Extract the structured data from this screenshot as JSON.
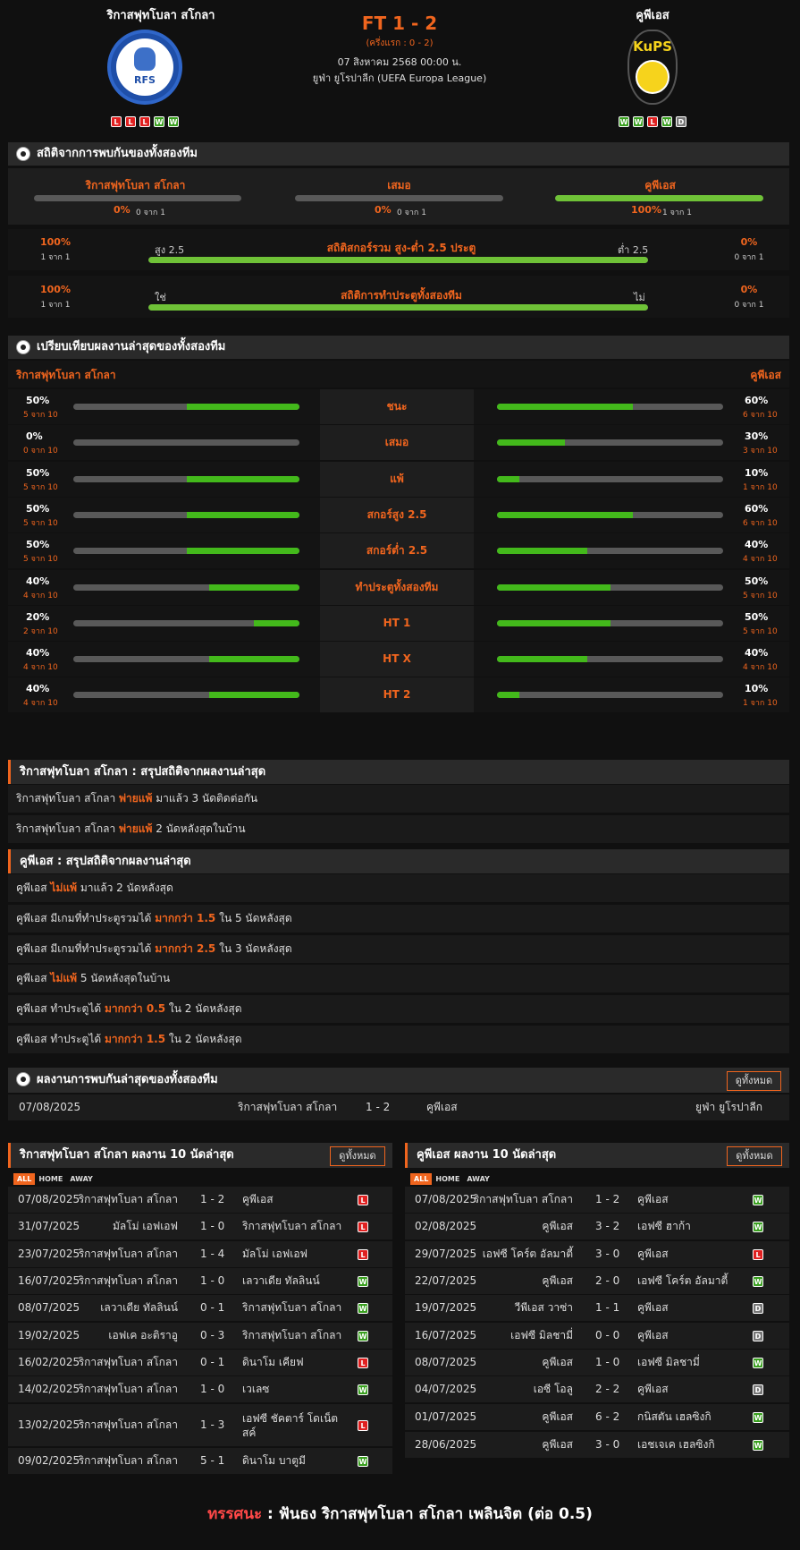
{
  "match": {
    "home": "ริกาสฟุทโบลา สโกลา",
    "away": "คูพีเอส",
    "score": "FT 1 - 2",
    "ht": "(ครึ่งแรก : 0 - 2)",
    "date": "07 สิงหาคม 2568 00:00 น.",
    "league": "ยูฟ่า ยูโรปาลีก (UEFA Europa League)",
    "home_logo_text": "RFS",
    "away_logo_text": "KuPS",
    "home_form": [
      "L",
      "L",
      "L",
      "W",
      "W"
    ],
    "away_form": [
      "W",
      "W",
      "L",
      "W",
      "D"
    ]
  },
  "h2h_stats": {
    "title": "สถิติจากการพบกันของทั้งสองทีม",
    "draw_label": "เสมอ",
    "home_pct": "0%",
    "home_sub": "0 จาก 1",
    "draw_pct": "0%",
    "draw_sub": "0 จาก 1",
    "away_pct": "100%",
    "away_sub": "1 จาก 1",
    "home_val": 0,
    "draw_val": 0,
    "away_val": 100
  },
  "ou": {
    "title": "สถิติสกอร์รวม สูง-ต่ำ 2.5 ประตู",
    "left_label": "สูง 2.5",
    "right_label": "ต่ำ 2.5",
    "left_pct": "100%",
    "left_sub": "1 จาก 1",
    "right_pct": "0%",
    "right_sub": "0 จาก 1",
    "value": 100
  },
  "btts": {
    "title": "สถิติการทำประตูทั้งสองทีม",
    "left_label": "ใช่",
    "right_label": "ไม่",
    "left_pct": "100%",
    "left_sub": "1 จาก 1",
    "right_pct": "0%",
    "right_sub": "0 จาก 1",
    "value": 100
  },
  "compare": {
    "title": "เปรียบเทียบผลงานล่าสุดของทั้งสองทีม",
    "rows": [
      {
        "label": "ชนะ",
        "lp": "50%",
        "ls": "5 จาก 10",
        "lv": 50,
        "rp": "60%",
        "rs": "6 จาก 10",
        "rv": 60
      },
      {
        "label": "เสมอ",
        "lp": "0%",
        "ls": "0 จาก 10",
        "lv": 0,
        "rp": "30%",
        "rs": "3 จาก 10",
        "rv": 30
      },
      {
        "label": "แพ้",
        "lp": "50%",
        "ls": "5 จาก 10",
        "lv": 50,
        "rp": "10%",
        "rs": "1 จาก 10",
        "rv": 10
      },
      {
        "label": "สกอร์สูง 2.5",
        "lp": "50%",
        "ls": "5 จาก 10",
        "lv": 50,
        "rp": "60%",
        "rs": "6 จาก 10",
        "rv": 60
      },
      {
        "label": "สกอร์ต่ำ 2.5",
        "lp": "50%",
        "ls": "5 จาก 10",
        "lv": 50,
        "rp": "40%",
        "rs": "4 จาก 10",
        "rv": 40
      },
      {
        "label": "ทำประตูทั้งสองทีม",
        "lp": "40%",
        "ls": "4 จาก 10",
        "lv": 40,
        "rp": "50%",
        "rs": "5 จาก 10",
        "rv": 50
      },
      {
        "label": "HT 1",
        "lp": "20%",
        "ls": "2 จาก 10",
        "lv": 20,
        "rp": "50%",
        "rs": "5 จาก 10",
        "rv": 50
      },
      {
        "label": "HT X",
        "lp": "40%",
        "ls": "4 จาก 10",
        "lv": 40,
        "rp": "40%",
        "rs": "4 จาก 10",
        "rv": 40
      },
      {
        "label": "HT 2",
        "lp": "40%",
        "ls": "4 จาก 10",
        "lv": 40,
        "rp": "10%",
        "rs": "1 จาก 10",
        "rv": 10
      }
    ]
  },
  "home_summary": {
    "title": "ริกาสฟุทโบลา สโกลา : สรุปสถิติจากผลงานล่าสุด",
    "rows": [
      {
        "a": "ริกาสฟุทโบลา สโกลา",
        "b": "พ่ายแพ้",
        "c": "มาแล้ว 3 นัดติดต่อกัน"
      },
      {
        "a": "ริกาสฟุทโบลา สโกลา",
        "b": "พ่ายแพ้",
        "c": "2  นัดหลังสุดในบ้าน"
      }
    ]
  },
  "away_summary": {
    "title": "คูพีเอส : สรุปสถิติจากผลงานล่าสุด",
    "rows": [
      {
        "a": "คูพีเอส",
        "b": "ไม่แพ้",
        "c": "มาแล้ว 2 นัดหลังสุด"
      },
      {
        "a": "คูพีเอส  มีเกมที่ทำประตูรวมได้",
        "b": "มากกว่า  1.5",
        "c": "ใน 5 นัดหลังสุด"
      },
      {
        "a": "คูพีเอส  มีเกมที่ทำประตูรวมได้",
        "b": "มากกว่า  2.5",
        "c": "ใน 3 นัดหลังสุด"
      },
      {
        "a": "คูพีเอส",
        "b": "ไม่แพ้",
        "c": "5  นัดหลังสุดในบ้าน"
      },
      {
        "a": "คูพีเอส  ทำประตูได้",
        "b": "มากกว่า  0.5",
        "c": "ใน 2 นัดหลังสุด"
      },
      {
        "a": "คูพีเอส  ทำประตูได้",
        "b": "มากกว่า  1.5",
        "c": "ใน 2 นัดหลังสุด"
      }
    ]
  },
  "h2h_results": {
    "title": "ผลงานการพบกันล่าสุดของทั้งสองทีม",
    "view_all": "ดูทั้งหมด",
    "row": {
      "date": "07/08/2025",
      "home": "ริกาสฟุทโบลา สโกลา",
      "score": "1 - 2",
      "away": "คูพีเอส",
      "comp": "ยูฟ่า ยูโรปาลีก"
    }
  },
  "tabs": [
    "ALL",
    "HOME",
    "AWAY"
  ],
  "home_last10": {
    "title": "ริกาสฟุทโบลา สโกลา ผลงาน 10 นัดล่าสุด",
    "view_all": "ดูทั้งหมด",
    "rows": [
      {
        "d": "07/08/2025",
        "h": "ริกาสฟุทโบลา สโกลา",
        "s": "1 - 2",
        "a": "คูพีเอส",
        "r": "L"
      },
      {
        "d": "31/07/2025",
        "h": "มัลโม่ เอฟเอฟ",
        "s": "1 - 0",
        "a": "ริกาสฟุทโบลา สโกลา",
        "r": "L"
      },
      {
        "d": "23/07/2025",
        "h": "ริกาสฟุทโบลา สโกลา",
        "s": "1 - 4",
        "a": "มัลโม่ เอฟเอฟ",
        "r": "L"
      },
      {
        "d": "16/07/2025",
        "h": "ริกาสฟุทโบลา สโกลา",
        "s": "1 - 0",
        "a": "เลวาเดีย ทัลลินน์",
        "r": "W"
      },
      {
        "d": "08/07/2025",
        "h": "เลวาเดีย ทัลลินน์",
        "s": "0 - 1",
        "a": "ริกาสฟุทโบลา สโกลา",
        "r": "W"
      },
      {
        "d": "19/02/2025",
        "h": "เอฟเค อะติราอู",
        "s": "0 - 3",
        "a": "ริกาสฟุทโบลา สโกลา",
        "r": "W"
      },
      {
        "d": "16/02/2025",
        "h": "ริกาสฟุทโบลา สโกลา",
        "s": "0 - 1",
        "a": "ดินาโม เคียฟ",
        "r": "L"
      },
      {
        "d": "14/02/2025",
        "h": "ริกาสฟุทโบลา สโกลา",
        "s": "1 - 0",
        "a": "เวเลซ",
        "r": "W"
      },
      {
        "d": "13/02/2025",
        "h": "ริกาสฟุทโบลา สโกลา",
        "s": "1 - 3",
        "a": "เอฟซี ชัคตาร์ โดเน็ตสค์",
        "r": "L"
      },
      {
        "d": "09/02/2025",
        "h": "ริกาสฟุทโบลา สโกลา",
        "s": "5 - 1",
        "a": "ดินาโม บาตูมี",
        "r": "W"
      }
    ]
  },
  "away_last10": {
    "title": "คูพีเอส ผลงาน 10 นัดล่าสุด",
    "view_all": "ดูทั้งหมด",
    "rows": [
      {
        "d": "07/08/2025",
        "h": "ริกาสฟุทโบลา สโกลา",
        "s": "1 - 2",
        "a": "คูพีเอส",
        "r": "W"
      },
      {
        "d": "02/08/2025",
        "h": "คูพีเอส",
        "s": "3 - 2",
        "a": "เอฟซี ฮาก้า",
        "r": "W"
      },
      {
        "d": "29/07/2025",
        "h": "เอฟซี โคร์ต อัลมาตี้",
        "s": "3 - 0",
        "a": "คูพีเอส",
        "r": "L"
      },
      {
        "d": "22/07/2025",
        "h": "คูพีเอส",
        "s": "2 - 0",
        "a": "เอฟซี โคร์ต อัลมาตี้",
        "r": "W"
      },
      {
        "d": "19/07/2025",
        "h": "วีพีเอส วาซ่า",
        "s": "1 - 1",
        "a": "คูพีเอส",
        "r": "D"
      },
      {
        "d": "16/07/2025",
        "h": "เอฟซี มิลชามี่",
        "s": "0 - 0",
        "a": "คูพีเอส",
        "r": "D"
      },
      {
        "d": "08/07/2025",
        "h": "คูพีเอส",
        "s": "1 - 0",
        "a": "เอฟซี มิลชามี่",
        "r": "W"
      },
      {
        "d": "04/07/2025",
        "h": "เอซี โอลู",
        "s": "2 - 2",
        "a": "คูพีเอส",
        "r": "D"
      },
      {
        "d": "01/07/2025",
        "h": "คูพีเอส",
        "s": "6 - 2",
        "a": "กนิสตัน เฮลซิงกิ",
        "r": "W"
      },
      {
        "d": "28/06/2025",
        "h": "คูพีเอส",
        "s": "3 - 0",
        "a": "เอชเจเค เฮลซิงกิ",
        "r": "W"
      }
    ]
  },
  "prediction": {
    "label": "ทรรศนะ",
    "colon": ":",
    "text": "ฟันธง ริกาสฟุทโบลา สโกลา เพลินจิต (ต่อ 0.5)"
  },
  "colors": {
    "accent": "#f0651e",
    "win": "#3aa020",
    "loss": "#e02020",
    "draw": "#777777",
    "bar_fill": "#6fc237"
  }
}
